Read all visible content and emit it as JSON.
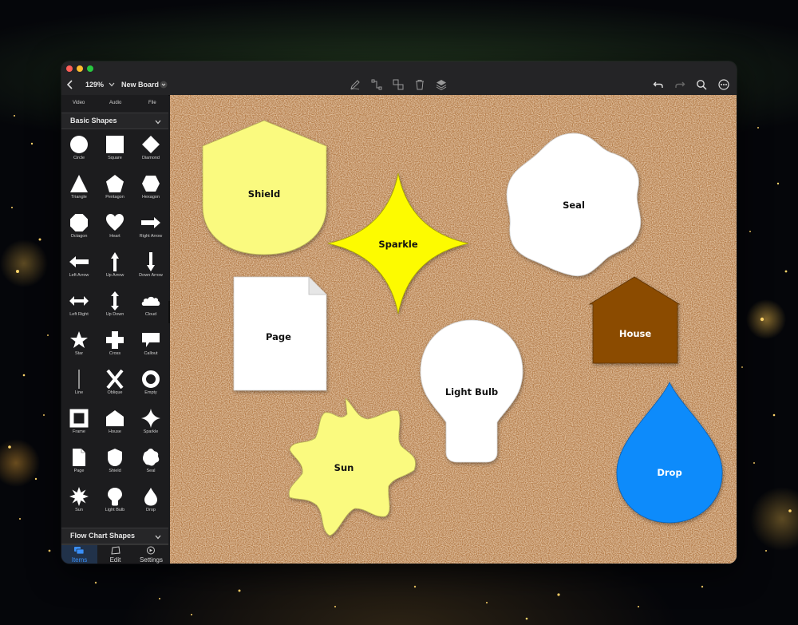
{
  "window": {
    "zoom": "129%",
    "board_title": "New Board"
  },
  "sidebar": {
    "media_items": [
      "Video",
      "Audio",
      "File"
    ],
    "section_title": "Basic Shapes",
    "shapes": [
      "Circle",
      "Square",
      "Diamond",
      "Triangle",
      "Pentagon",
      "Hexagon",
      "Octagon",
      "Heart",
      "Right Arrow",
      "Left Arrow",
      "Up Arrow",
      "Down Arrow",
      "Left Right",
      "Up Down",
      "Cloud",
      "Star",
      "Cross",
      "Callout",
      "Line",
      "Oblique",
      "Empty",
      "Frame",
      "House",
      "Sparkle",
      "Page",
      "Shield",
      "Seal",
      "Sun",
      "Light Bulb",
      "Drop"
    ],
    "next_section_title": "Flow Chart Shapes",
    "tabs": [
      "Items",
      "Edit",
      "Settings"
    ]
  },
  "board": {
    "shapes": [
      {
        "name": "Shield",
        "color": "#fafa7f"
      },
      {
        "name": "Sparkle",
        "color": "#fdfb03"
      },
      {
        "name": "Seal",
        "color": "#ffffff"
      },
      {
        "name": "Page",
        "color": "#ffffff"
      },
      {
        "name": "House",
        "color": "#8b4b00"
      },
      {
        "name": "Light Bulb",
        "color": "#ffffff"
      },
      {
        "name": "Sun",
        "color": "#fafa7f"
      },
      {
        "name": "Drop",
        "color": "#0f8bfb"
      }
    ]
  },
  "colors": {
    "accent": "#3a8ff7",
    "cork": "#c6915c"
  }
}
